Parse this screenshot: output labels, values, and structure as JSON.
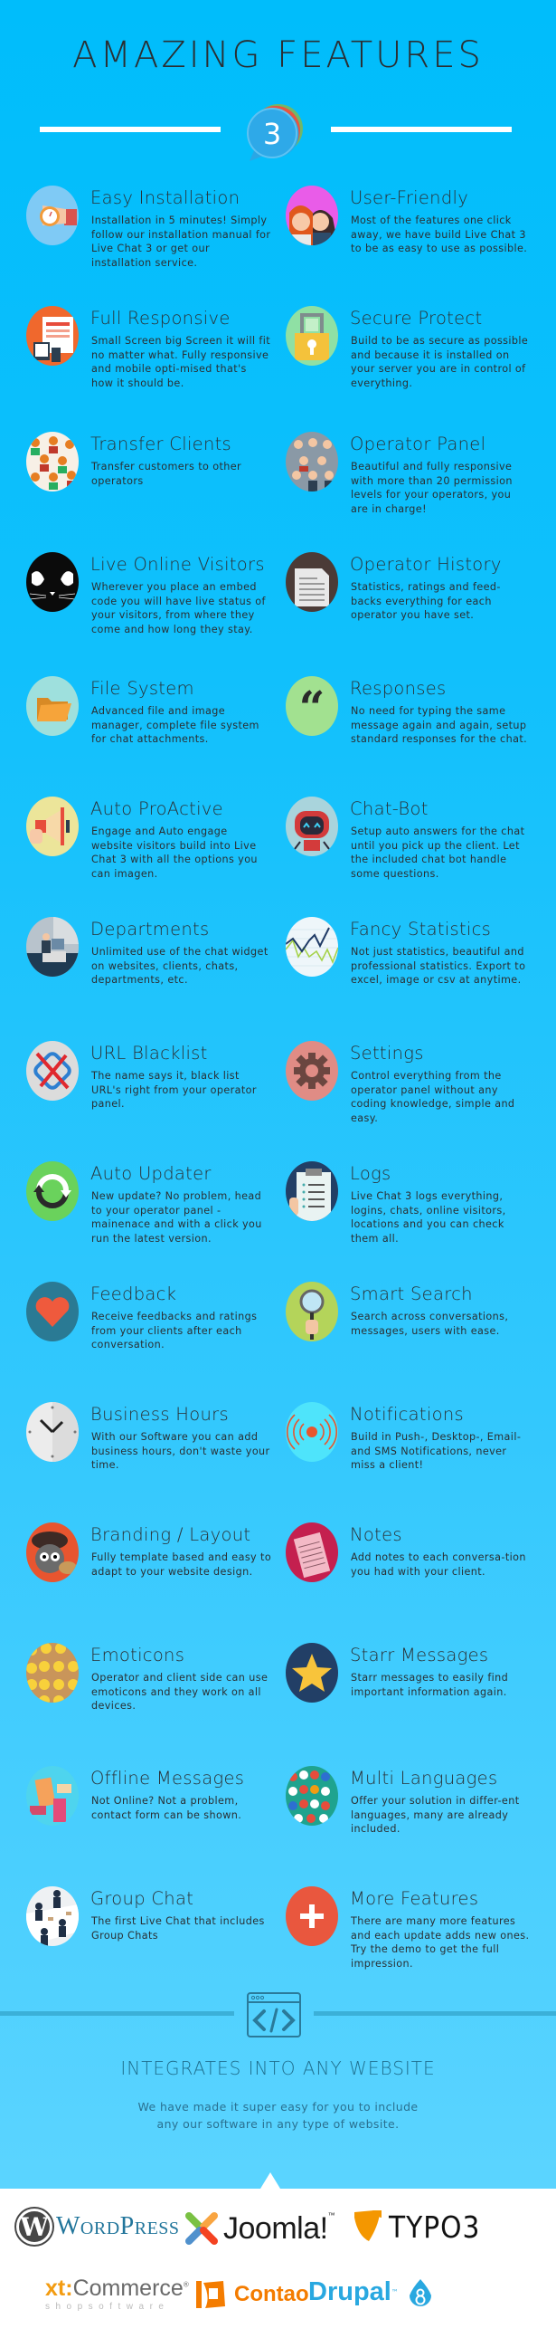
{
  "header": {
    "title": "AMAZING FEATURES",
    "badge_number": "3"
  },
  "features": [
    {
      "title": "Easy Installation",
      "desc": "Installation in 5 minutes! Simply follow our installation manual for Live Chat 3 or get our installation service.",
      "icon": "stopwatch-hand-icon"
    },
    {
      "title": "User-Friendly",
      "desc": "Most of the features one click away, we have build Live Chat 3 to be as easy to use as possible.",
      "icon": "people-avatars-icon"
    },
    {
      "title": "Full Responsive",
      "desc": "Small Screen big Screen it will fit no matter what. Fully responsive and mobile opti-mised that's how it should be.",
      "icon": "responsive-devices-icon"
    },
    {
      "title": "Secure Protect",
      "desc": "Build to be as secure as possible and because it is installed on your server you are in control of everything.",
      "icon": "padlock-icon"
    },
    {
      "title": "Transfer Clients",
      "desc": "Transfer customers to other operators",
      "icon": "crowd-icon"
    },
    {
      "title": "Operator Panel",
      "desc": "Beautiful and fully responsive with more than 20 permission levels for your operators, you are in charge!",
      "icon": "operators-team-icon"
    },
    {
      "title": "Live Online Visitors",
      "desc": "Wherever you place an embed code you will have live status of your visitors, from where they come and how long they stay.",
      "icon": "cat-eyes-icon"
    },
    {
      "title": "Operator History",
      "desc": "Statistics, ratings and feed-backs everything for each operator you have set.",
      "icon": "document-icon"
    },
    {
      "title": "File System",
      "desc": "Advanced file and image manager, complete file system for chat attachments.",
      "icon": "folder-icon"
    },
    {
      "title": "Responses",
      "desc": "No need for typing the same message again and again, setup standard responses for the chat.",
      "icon": "quote-icon"
    },
    {
      "title": "Auto ProActive",
      "desc": "Engage and Auto engage website visitors build into Live Chat 3 with all the options you can imagen.",
      "icon": "megaphone-icon"
    },
    {
      "title": "Chat-Bot",
      "desc": "Setup auto answers for the chat until you pick up the client. Let the included chat bot handle some questions.",
      "icon": "robot-icon"
    },
    {
      "title": "Departments",
      "desc": "Unlimited use of the chat widget on websites, clients, chats, departments, etc.",
      "icon": "office-desk-icon"
    },
    {
      "title": "Fancy Statistics",
      "desc": "Not just statistics, beautiful and professional statistics. Export to excel, image or csv at anytime.",
      "icon": "line-chart-icon"
    },
    {
      "title": "URL Blacklist",
      "desc": "The name says it, black list URL's right from your operator panel.",
      "icon": "blocked-link-icon"
    },
    {
      "title": "Settings",
      "desc": "Control everything from the operator panel without any coding knowledge, simple and easy.",
      "icon": "gear-icon"
    },
    {
      "title": "Auto Updater",
      "desc": "New update? No problem, head to your operator panel - mainenace and with a click you run the latest version.",
      "icon": "refresh-arrows-icon"
    },
    {
      "title": "Logs",
      "desc": "Live Chat 3 logs everything, logins, chats, online visitors, locations and you can check them all.",
      "icon": "clipboard-icon"
    },
    {
      "title": "Feedback",
      "desc": "Receive feedbacks and ratings from your clients after each conversation.",
      "icon": "heart-icon"
    },
    {
      "title": "Smart Search",
      "desc": "Search across conversations, messages, users with ease.",
      "icon": "magnifier-icon"
    },
    {
      "title": "Business Hours",
      "desc": "With our Software you can add business hours, don't waste your time.",
      "icon": "clock-icon"
    },
    {
      "title": "Notifications",
      "desc": "Build in Push-, Desktop-, Email- and SMS Notifications, never miss a client!",
      "icon": "broadcast-icon"
    },
    {
      "title": "Branding / Layout",
      "desc": "Fully template based and easy to adapt to your website design.",
      "icon": "painter-raccoon-icon"
    },
    {
      "title": "Notes",
      "desc": "Add notes to each conversa-tion you had with your client.",
      "icon": "notepad-icon"
    },
    {
      "title": "Emoticons",
      "desc": "Operator and client side can use emoticons and they work on all devices.",
      "icon": "emoji-grid-icon"
    },
    {
      "title": "Starr Messages",
      "desc": "Starr messages to easily find important information again.",
      "icon": "star-icon"
    },
    {
      "title": "Offline Messages",
      "desc": "Not Online? Not a problem, contact form can be shown.",
      "icon": "phone-messages-icon"
    },
    {
      "title": "Multi Languages",
      "desc": "Offer your solution in differ-ent languages, many are already included.",
      "icon": "flags-icon"
    },
    {
      "title": "Group Chat",
      "desc": "The first Live Chat that includes Group Chats",
      "icon": "meeting-table-icon"
    },
    {
      "title": "More Features",
      "desc": "There are many more features and each update adds new ones. Try the demo to get the full impression.",
      "icon": "plus-icon"
    }
  ],
  "integrates": {
    "title": "INTEGRATES INTO ANY WEBSITE",
    "desc_line1": "We have made it super easy for you to include",
    "desc_line2": "any our software in any type of website."
  },
  "platforms": {
    "wordpress": "WordPress",
    "joomla": "Joomla!",
    "joomla_tm": "™",
    "typo3": "TYPO3",
    "xtcommerce_prefix": "xt:",
    "xtcommerce": "Commerce",
    "xtcommerce_reg": "®",
    "xtcommerce_sub": "shopsoftware",
    "contao": "Contao",
    "drupal": "Drupal",
    "drupal_tm": "™"
  },
  "colors": {
    "background_top": "#00bdfb",
    "background_bottom": "#5bd4ff",
    "text": "#2a2f33",
    "integrates_text": "#1f6f8e"
  }
}
